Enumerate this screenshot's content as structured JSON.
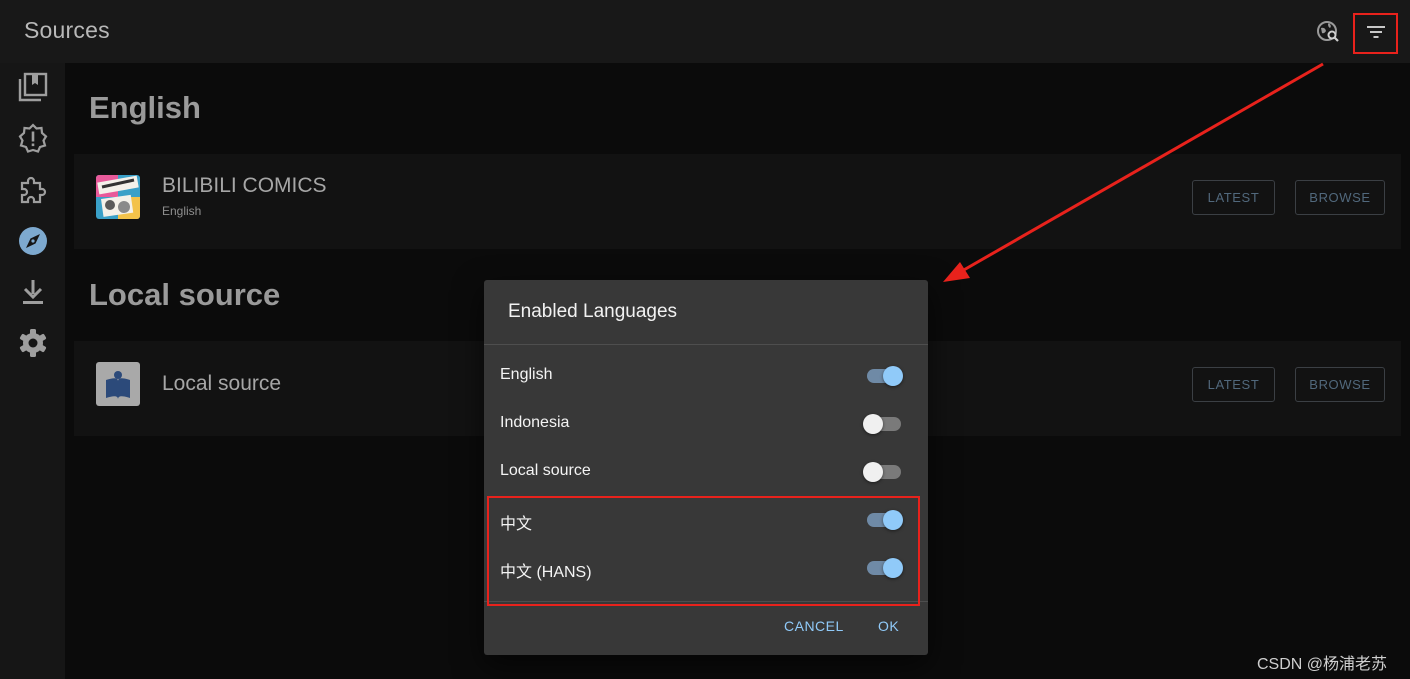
{
  "appbar": {
    "title": "Sources",
    "icons": [
      "travel-explore-icon",
      "filter-list-icon"
    ]
  },
  "sidebar": {
    "items": [
      {
        "name": "library-icon"
      },
      {
        "name": "updates-icon"
      },
      {
        "name": "extensions-icon"
      },
      {
        "name": "browse-icon",
        "active": true
      },
      {
        "name": "downloads-icon"
      },
      {
        "name": "settings-icon"
      }
    ]
  },
  "sections": [
    {
      "title": "English",
      "source": {
        "name": "BILIBILI COMICS",
        "language": "English",
        "latest_label": "LATEST",
        "browse_label": "BROWSE"
      }
    },
    {
      "title": "Local source",
      "source": {
        "name": "Local source",
        "latest_label": "LATEST",
        "browse_label": "BROWSE"
      }
    }
  ],
  "dialog": {
    "title": "Enabled Languages",
    "languages": [
      {
        "label": "English",
        "enabled": true
      },
      {
        "label": "Indonesia",
        "enabled": false
      },
      {
        "label": "Local source",
        "enabled": false
      },
      {
        "label": "中文",
        "enabled": true
      },
      {
        "label": "中文 (HANS)",
        "enabled": true
      }
    ],
    "cancel_label": "CANCEL",
    "ok_label": "OK"
  },
  "watermark": "CSDN @杨浦老苏",
  "colors": {
    "accent": "#90caf9",
    "annotation": "#e8221c"
  }
}
